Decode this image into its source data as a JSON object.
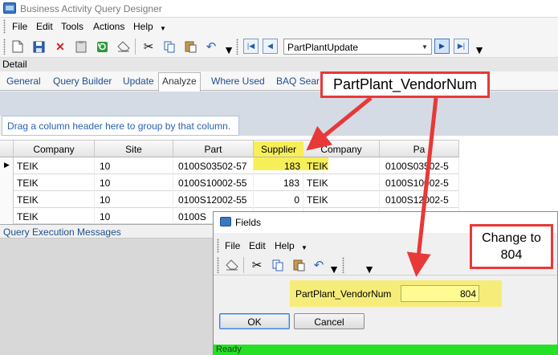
{
  "window": {
    "title": "Business Activity Query Designer"
  },
  "menu": {
    "items": [
      "File",
      "Edit",
      "Tools",
      "Actions",
      "Help"
    ]
  },
  "toolbar": {
    "icons": [
      "new-file-icon",
      "save-icon",
      "delete-icon",
      "clipboard-icon",
      "refresh-icon",
      "eraser-icon",
      "cut-icon",
      "copy-icon",
      "paste-icon",
      "undo-icon"
    ],
    "record_value": "PartPlantUpdate"
  },
  "detail_label": "Detail",
  "tabs": [
    "General",
    "Query Builder",
    "Update",
    "Analyze",
    "Where Used",
    "BAQ Sear"
  ],
  "active_tab": "Analyze",
  "grid": {
    "group_hint": "Drag a column header here to group by that column.",
    "columns": [
      "Company",
      "Site",
      "Part",
      "Supplier",
      "Company",
      "Pa"
    ],
    "rows": [
      [
        "TEIK",
        "10",
        "0100S03502-57",
        "183",
        "TEIK",
        "0100S03502-5"
      ],
      [
        "TEIK",
        "10",
        "0100S10002-55",
        "183",
        "TEIK",
        "0100S10002-5"
      ],
      [
        "TEIK",
        "10",
        "0100S12002-55",
        "0",
        "TEIK",
        "0100S12002-5"
      ],
      [
        "TEIK",
        "10",
        "0100S",
        "",
        "",
        ""
      ]
    ]
  },
  "messages_panel": {
    "title": "Query Execution Messages"
  },
  "fields_dialog": {
    "title": "Fields",
    "menu": [
      "File",
      "Edit",
      "Help"
    ],
    "field_label": "PartPlant_VendorNum",
    "field_value": "804",
    "ok_label": "OK",
    "cancel_label": "Cancel",
    "status": "Ready"
  },
  "annotations": {
    "callout_1": "PartPlant_VendorNum",
    "callout_2_line1": "Change to",
    "callout_2_line2": "804",
    "highlight_color": "#f7ef57",
    "arrow_color": "#e83838"
  }
}
